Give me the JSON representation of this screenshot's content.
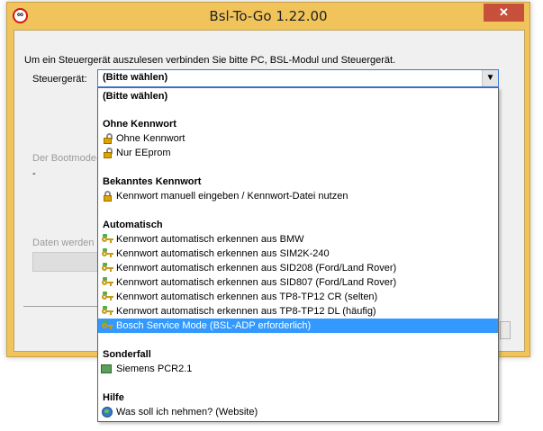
{
  "window": {
    "title": "Bsl-To-Go  1.22.00",
    "icon": "infinity-badge-icon",
    "close_label": "✕"
  },
  "main": {
    "intro_text": "Um ein Steuergerät auszulesen verbinden Sie bitte PC, BSL-Modul und Steuergerät.",
    "device_label": "Steuergerät:",
    "device_selected": "(Bitte wählen)",
    "faded_bootmode_label": "Der Bootmode-",
    "faded_bootmode_value": "-",
    "faded_data_label": "Daten werden g"
  },
  "dropdown": {
    "rows": [
      {
        "type": "item-plain",
        "label": "(Bitte wählen)"
      },
      {
        "type": "header",
        "label": "Ohne Kennwort"
      },
      {
        "type": "item",
        "icon": "unlocked-padlock-icon",
        "label": "Ohne Kennwort"
      },
      {
        "type": "item",
        "icon": "unlocked-padlock-icon",
        "label": "Nur EEprom"
      },
      {
        "type": "header",
        "label": "Bekanntes Kennwort"
      },
      {
        "type": "item",
        "icon": "locked-padlock-icon",
        "label": "Kennwort manuell eingeben / Kennwort-Datei nutzen"
      },
      {
        "type": "header",
        "label": "Automatisch"
      },
      {
        "type": "item",
        "icon": "key-icon",
        "label": "Kennwort automatisch erkennen aus BMW"
      },
      {
        "type": "item",
        "icon": "key-icon",
        "label": "Kennwort automatisch erkennen aus SIM2K-240"
      },
      {
        "type": "item",
        "icon": "key-icon",
        "label": "Kennwort automatisch erkennen aus SID208 (Ford/Land Rover)"
      },
      {
        "type": "item",
        "icon": "key-icon",
        "label": "Kennwort automatisch erkennen aus SID807 (Ford/Land Rover)"
      },
      {
        "type": "item",
        "icon": "key-icon",
        "label": "Kennwort automatisch erkennen aus TP8-TP12 CR (selten)"
      },
      {
        "type": "item",
        "icon": "key-icon",
        "label": "Kennwort automatisch erkennen aus TP8-TP12 DL (häufig)"
      },
      {
        "type": "item",
        "icon": "key-icon",
        "label": "Bosch Service Mode (BSL-ADP erforderlich)",
        "selected": true
      },
      {
        "type": "header",
        "label": "Sonderfall"
      },
      {
        "type": "item",
        "icon": "chip-icon",
        "label": "Siemens PCR2.1"
      },
      {
        "type": "header",
        "label": "Hilfe"
      },
      {
        "type": "item",
        "icon": "globe-icon",
        "label": "Was soll ich nehmen? (Website)"
      }
    ]
  },
  "colors": {
    "window_frame": "#f0c45a",
    "close_button": "#c7503a",
    "selection": "#3399ff"
  }
}
